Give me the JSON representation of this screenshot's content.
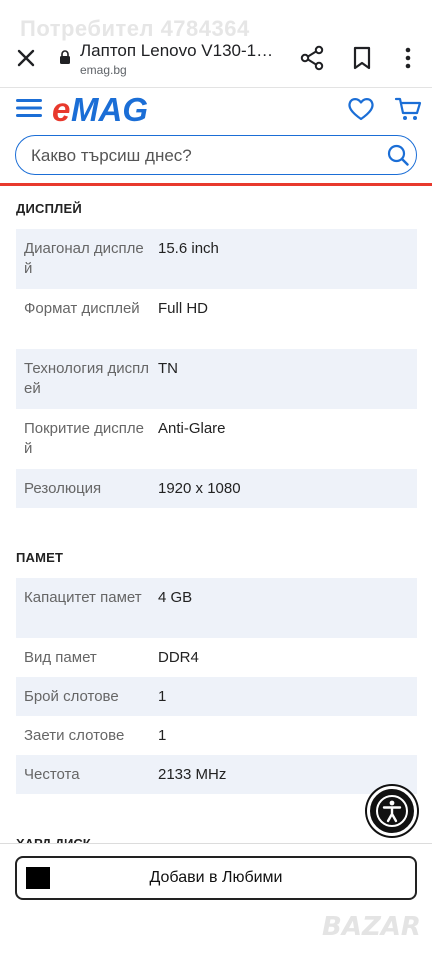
{
  "watermark": {
    "user": "Потребител 4784364",
    "bazar": "BAZAR"
  },
  "browser": {
    "title": "Лаптоп Lenovo V130-15…",
    "url": "emag.bg",
    "icons": [
      "close-icon",
      "lock-icon",
      "share-icon",
      "bookmark-icon",
      "more-icon"
    ]
  },
  "site": {
    "logo": "eMAG",
    "search": {
      "placeholder": "Какво търсиш днес?",
      "value": ""
    },
    "icons": [
      "menu-icon",
      "heart-icon",
      "cart-icon",
      "search-icon"
    ],
    "colors": {
      "brand_red": "#e8392d",
      "brand_blue": "#1b6ed6"
    }
  },
  "specs": {
    "display": {
      "title": "ДИСПЛЕЙ",
      "rows": [
        {
          "label": "Диагонал дисплей",
          "value": "15.6 inch"
        },
        {
          "label": "Формат дисплей",
          "value": "Full HD"
        },
        {
          "label": "Технология дисплей",
          "value": "TN"
        },
        {
          "label": "Покритие дисплей",
          "value": "Anti-Glare"
        },
        {
          "label": "Резолюция",
          "value": "1920 x 1080"
        }
      ]
    },
    "memory": {
      "title": "ПАМЕТ",
      "rows": [
        {
          "label": "Капацитет памет",
          "value": "4 GB"
        },
        {
          "label": "Вид памет",
          "value": "DDR4"
        },
        {
          "label": "Брой слотове",
          "value": "1"
        },
        {
          "label": "Заети слотове",
          "value": "1"
        },
        {
          "label": "Честота",
          "value": "2133 MHz"
        }
      ]
    },
    "next_section_title": "ХАРД ДИСК"
  },
  "bottom_bar": {
    "favorite_label": "Добави в Любими"
  },
  "accessibility": {
    "icon": "accessibility-icon"
  }
}
